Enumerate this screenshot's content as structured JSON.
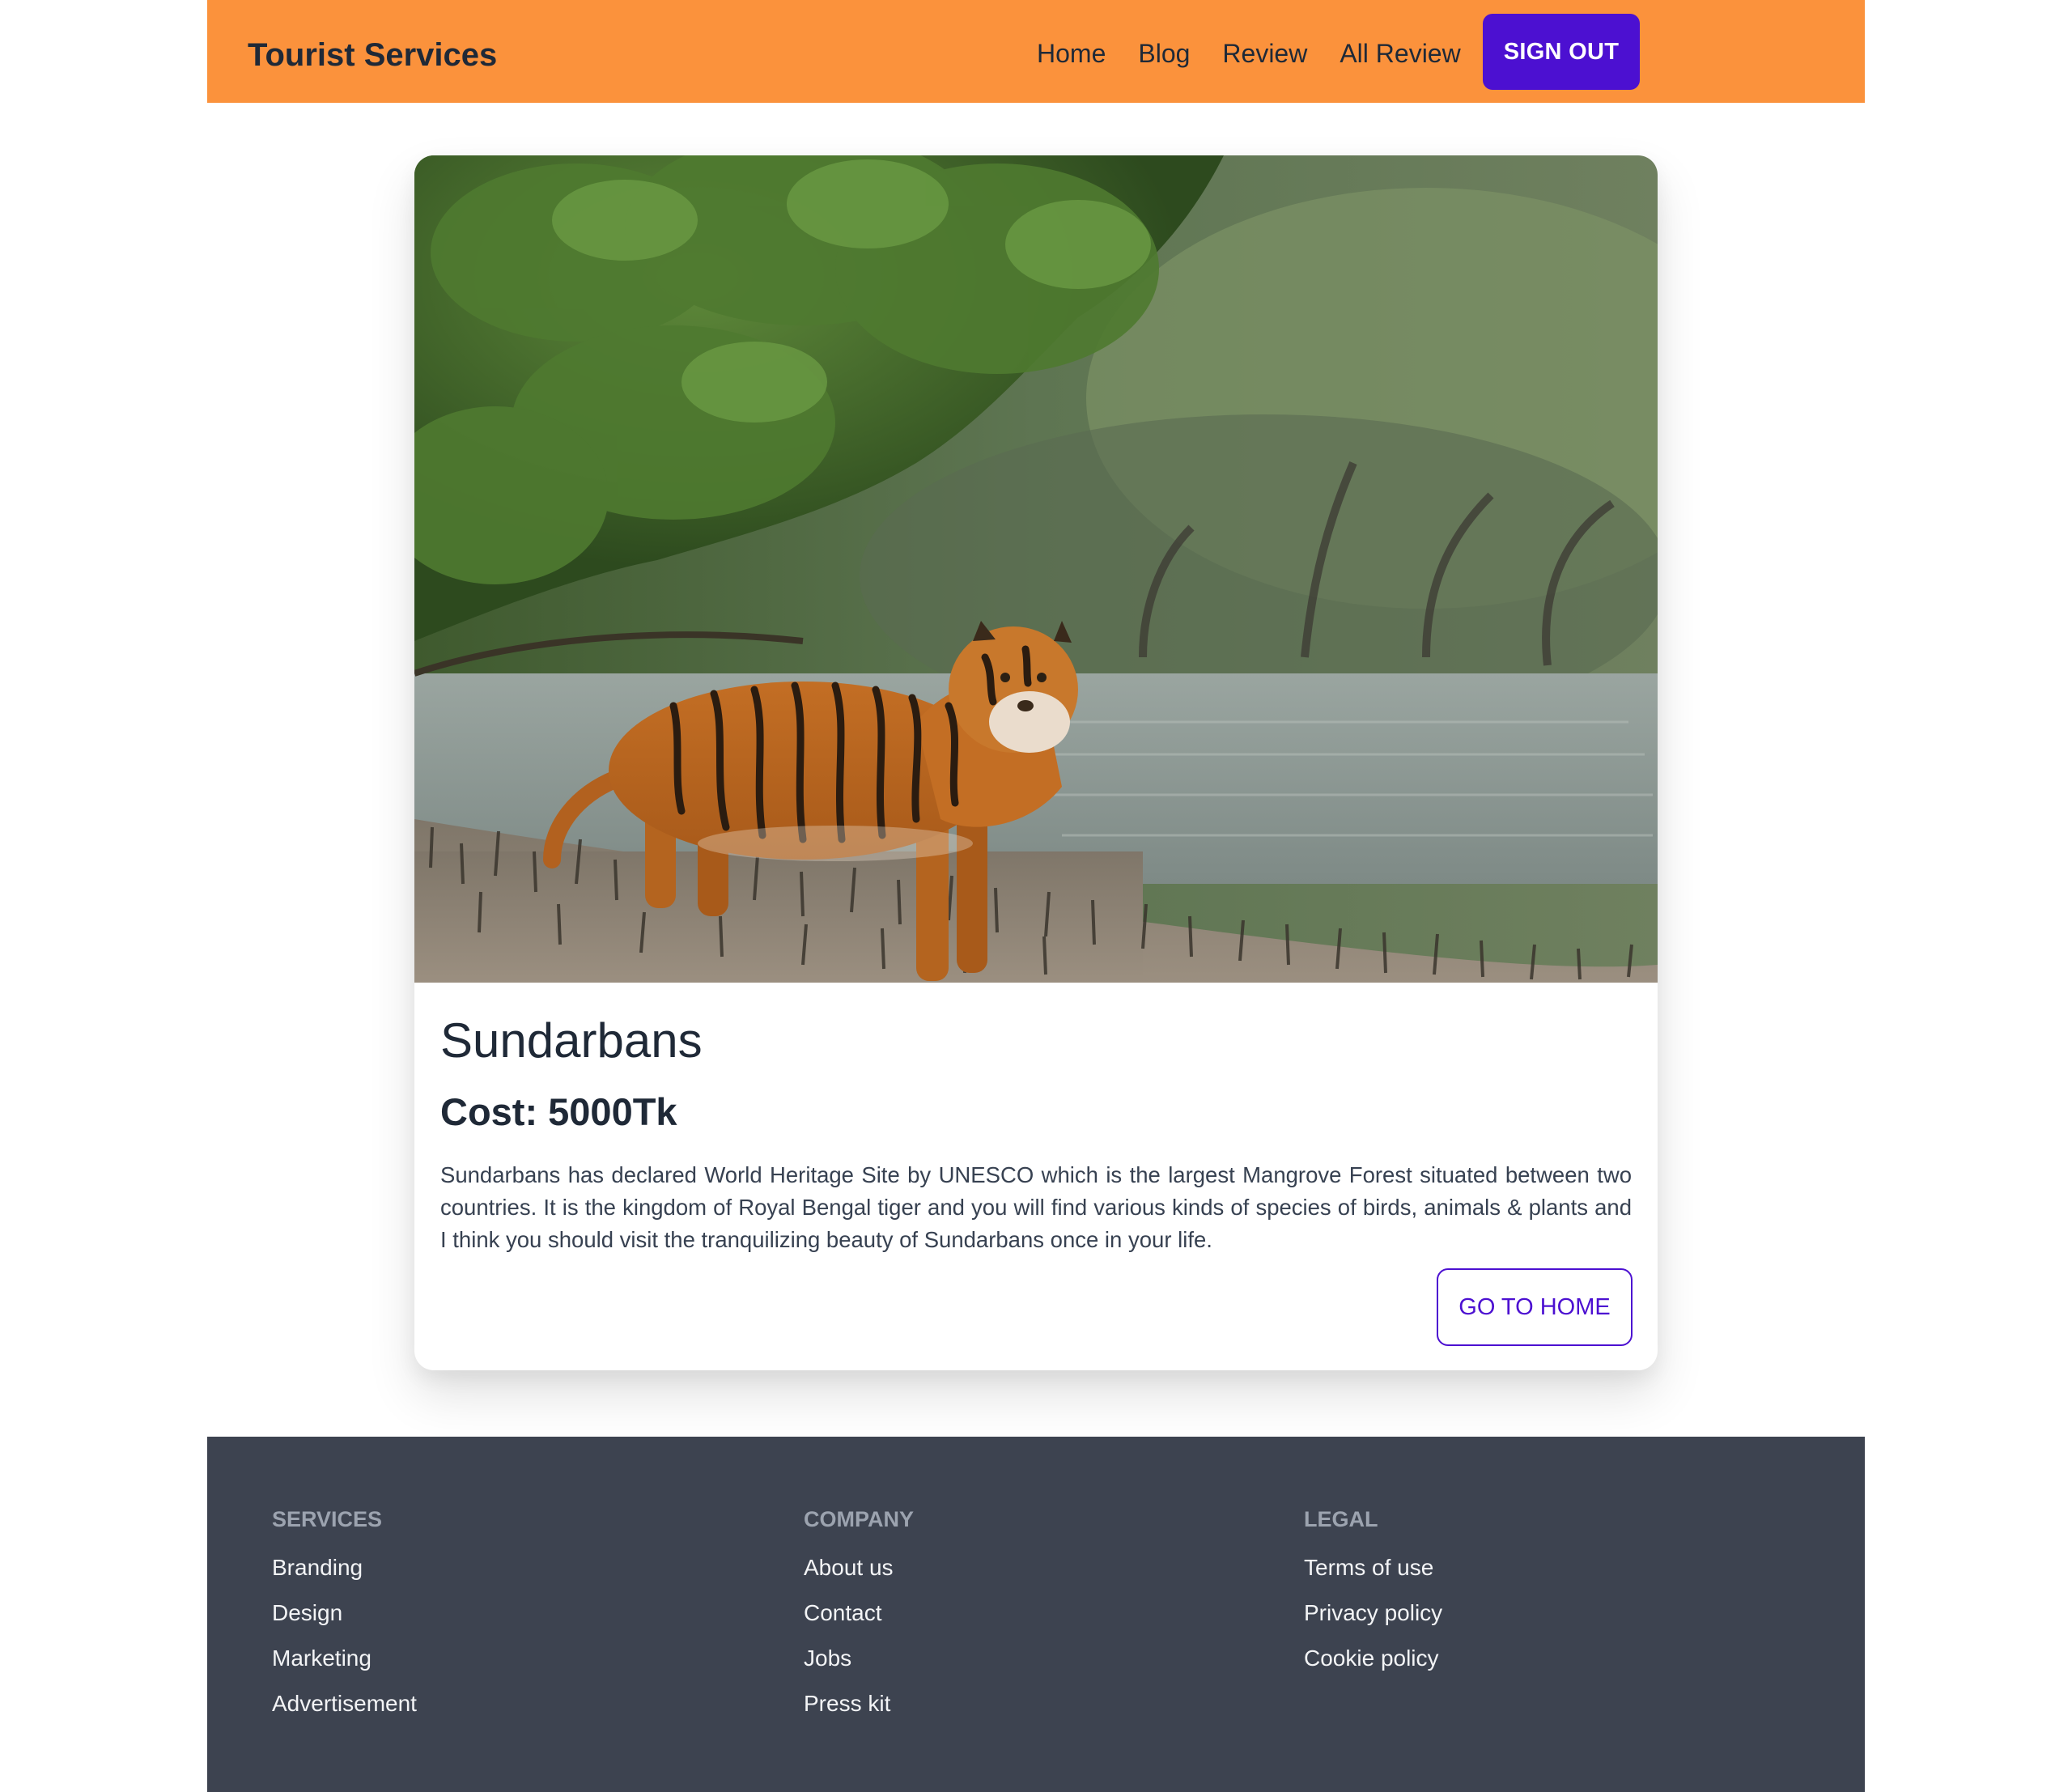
{
  "header": {
    "brand": "Tourist Services",
    "nav": [
      "Home",
      "Blog",
      "Review",
      "All Review"
    ],
    "sign_out": "SIGN OUT",
    "bg_color": "#fb923c",
    "accent_color": "#4c10d1"
  },
  "card": {
    "image_alt": "Bengal tiger standing on mangrove mudflat beside a river",
    "title": "Sundarbans",
    "cost": "Cost: 5000Tk",
    "description": "Sundarbans has declared World Heritage Site by UNESCO which is the largest Mangrove Forest situated between two countries. It is the kingdom of Royal Bengal tiger and you will find various kinds of species of birds, animals & plants and I think you should visit the tranquilizing beauty of Sundarbans once in your life.",
    "button": "GO TO HOME"
  },
  "footer": {
    "bg_color": "#3d4350",
    "columns": [
      {
        "heading": "SERVICES",
        "links": [
          "Branding",
          "Design",
          "Marketing",
          "Advertisement"
        ]
      },
      {
        "heading": "COMPANY",
        "links": [
          "About us",
          "Contact",
          "Jobs",
          "Press kit"
        ]
      },
      {
        "heading": "LEGAL",
        "links": [
          "Terms of use",
          "Privacy policy",
          "Cookie policy"
        ]
      }
    ]
  }
}
